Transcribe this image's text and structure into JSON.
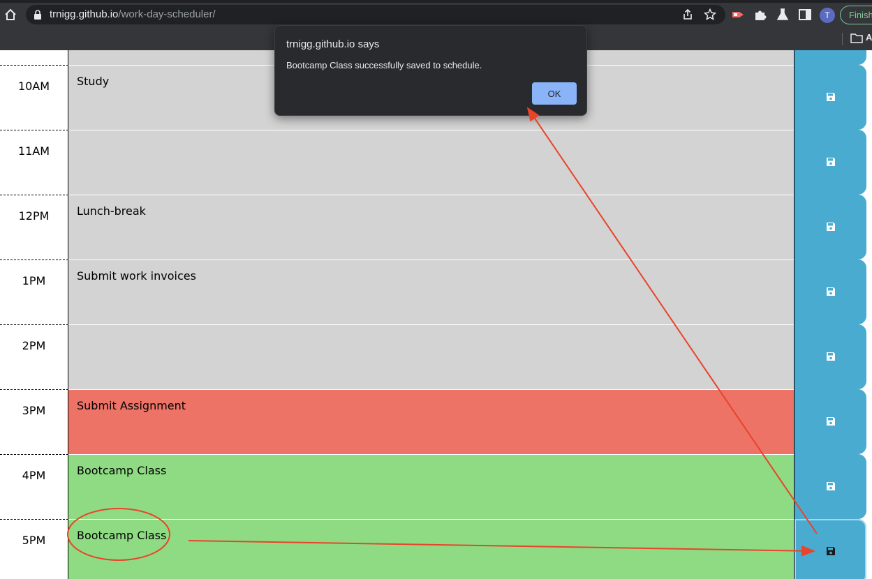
{
  "browser": {
    "url_host": "trnigg.github.io",
    "url_path": "/work-day-scheduler/",
    "avatar_letter": "T",
    "finish_label": "Finish",
    "bookmark_label": "A"
  },
  "scheduler": {
    "rows": [
      {
        "hour": "",
        "text": "",
        "state": "past"
      },
      {
        "hour": "10AM",
        "text": "Study",
        "state": "past"
      },
      {
        "hour": "11AM",
        "text": "",
        "state": "past"
      },
      {
        "hour": "12PM",
        "text": "Lunch-break",
        "state": "past"
      },
      {
        "hour": "1PM",
        "text": "Submit work invoices",
        "state": "past"
      },
      {
        "hour": "2PM",
        "text": "",
        "state": "past"
      },
      {
        "hour": "3PM",
        "text": "Submit Assignment",
        "state": "present"
      },
      {
        "hour": "4PM",
        "text": "Bootcamp Class",
        "state": "future"
      },
      {
        "hour": "5PM",
        "text": "Bootcamp Class",
        "state": "future"
      }
    ]
  },
  "dialog": {
    "title": "trnigg.github.io says",
    "message": "Bootcamp Class successfully saved to schedule.",
    "ok_label": "OK"
  },
  "colors": {
    "past": "#d3d3d3",
    "present": "#ee7367",
    "future": "#8fdb83",
    "save_button": "#4aabd1",
    "annotation": "#e8442a"
  },
  "icons": {
    "save": "floppy-disk-icon"
  }
}
